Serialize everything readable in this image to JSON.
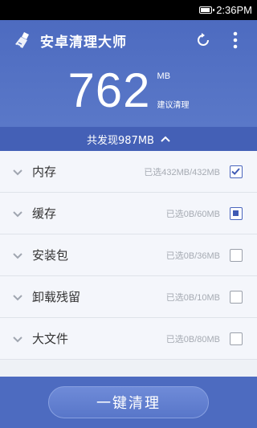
{
  "status": {
    "time": "2:36PM",
    "battery_level": 0.95
  },
  "header": {
    "app_title": "安卓清理大师",
    "size_value": "762",
    "size_unit": "MB",
    "size_hint": "建议清理",
    "icons": [
      "broom-icon",
      "refresh-icon",
      "more-vert-icon"
    ]
  },
  "found_bar": {
    "label": "共发现987MB",
    "icon": "chevron-up-icon"
  },
  "items": [
    {
      "label": "内存",
      "detail": "已选432MB/432MB",
      "check": "checked"
    },
    {
      "label": "缓存",
      "detail": "已选0B/60MB",
      "check": "partial"
    },
    {
      "label": "安装包",
      "detail": "已选0B/36MB",
      "check": "unchecked"
    },
    {
      "label": "卸载残留",
      "detail": "已选0B/10MB",
      "check": "unchecked"
    },
    {
      "label": "大文件",
      "detail": "已选0B/80MB",
      "check": "unchecked"
    }
  ],
  "bottom": {
    "clean_button": "一键清理"
  },
  "colors": {
    "primary": "#4d6bc0",
    "accent": "#4a65bd"
  }
}
